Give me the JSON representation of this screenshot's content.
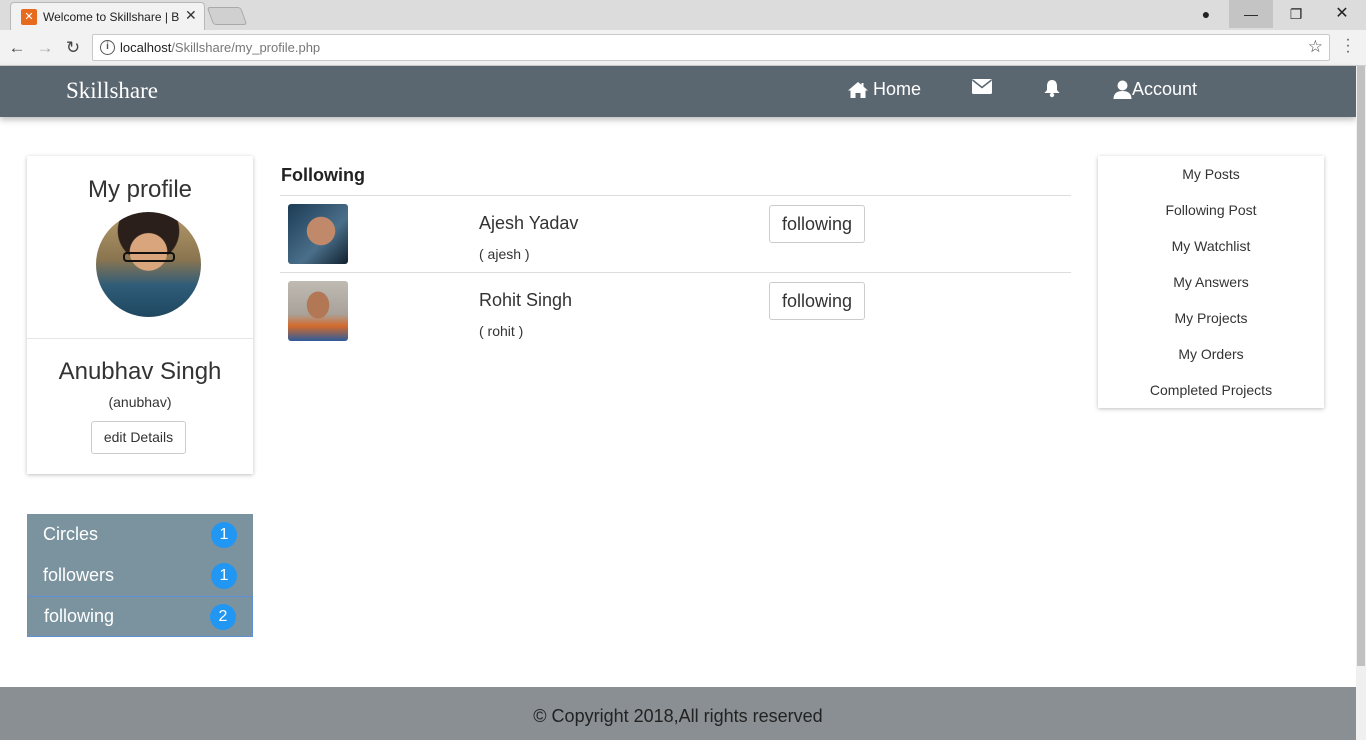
{
  "browser": {
    "tab_title": "Welcome to Skillshare | B",
    "url_host": "localhost",
    "url_path": "/Skillshare/my_profile.php"
  },
  "navbar": {
    "brand": "Skillshare",
    "home_label": "Home",
    "account_label": "Account"
  },
  "profile": {
    "heading": "My profile",
    "name": "Anubhav Singh",
    "username": "(anubhav)",
    "edit_label": "edit Details"
  },
  "stats": [
    {
      "label": "Circles",
      "count": "1"
    },
    {
      "label": "followers",
      "count": "1"
    },
    {
      "label": "following",
      "count": "2"
    }
  ],
  "following": {
    "title": "Following",
    "rows": [
      {
        "name": "Ajesh Yadav",
        "handle": "( ajesh )",
        "button": "following"
      },
      {
        "name": "Rohit Singh",
        "handle": "( rohit )",
        "button": "following"
      }
    ]
  },
  "menu": [
    "My Posts",
    "Following Post",
    "My Watchlist",
    "My Answers",
    "My Projects",
    "My Orders",
    "Completed Projects"
  ],
  "footer": {
    "text": "© Copyright 2018,All rights reserved"
  }
}
